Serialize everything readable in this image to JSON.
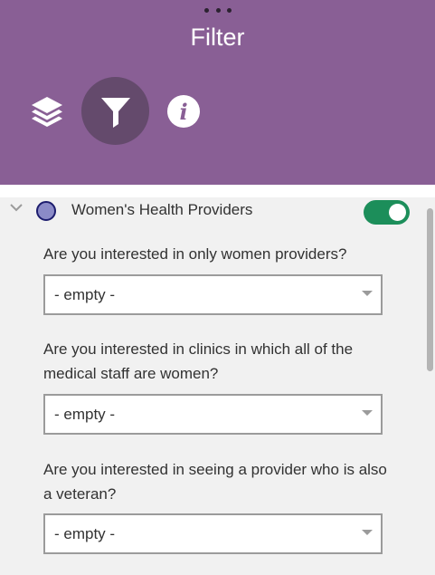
{
  "header": {
    "title": "Filter",
    "tabs": [
      {
        "icon": "layers-icon",
        "active": false
      },
      {
        "icon": "filter-icon",
        "active": true
      },
      {
        "icon": "info-icon",
        "glyph": "i",
        "active": false
      }
    ]
  },
  "layer": {
    "name": "Women's Health Providers",
    "expand_icon": "chevron-down-icon",
    "enabled": true,
    "swatch_color": "#8b8bc7"
  },
  "filters": [
    {
      "question": "Are you interested in only women providers?",
      "value": "- empty -"
    },
    {
      "question": "Are you interested in clinics in which all of the medical staff are women?",
      "value": "- empty -"
    },
    {
      "question": "Are you interested in seeing a provider who is also a veteran?",
      "value": "- empty -"
    }
  ],
  "colors": {
    "header_bg": "#895f95",
    "active_tab_bg": "#644a6c",
    "toggle_on": "#1c8e5a",
    "content_bg": "#f1f1f1"
  }
}
